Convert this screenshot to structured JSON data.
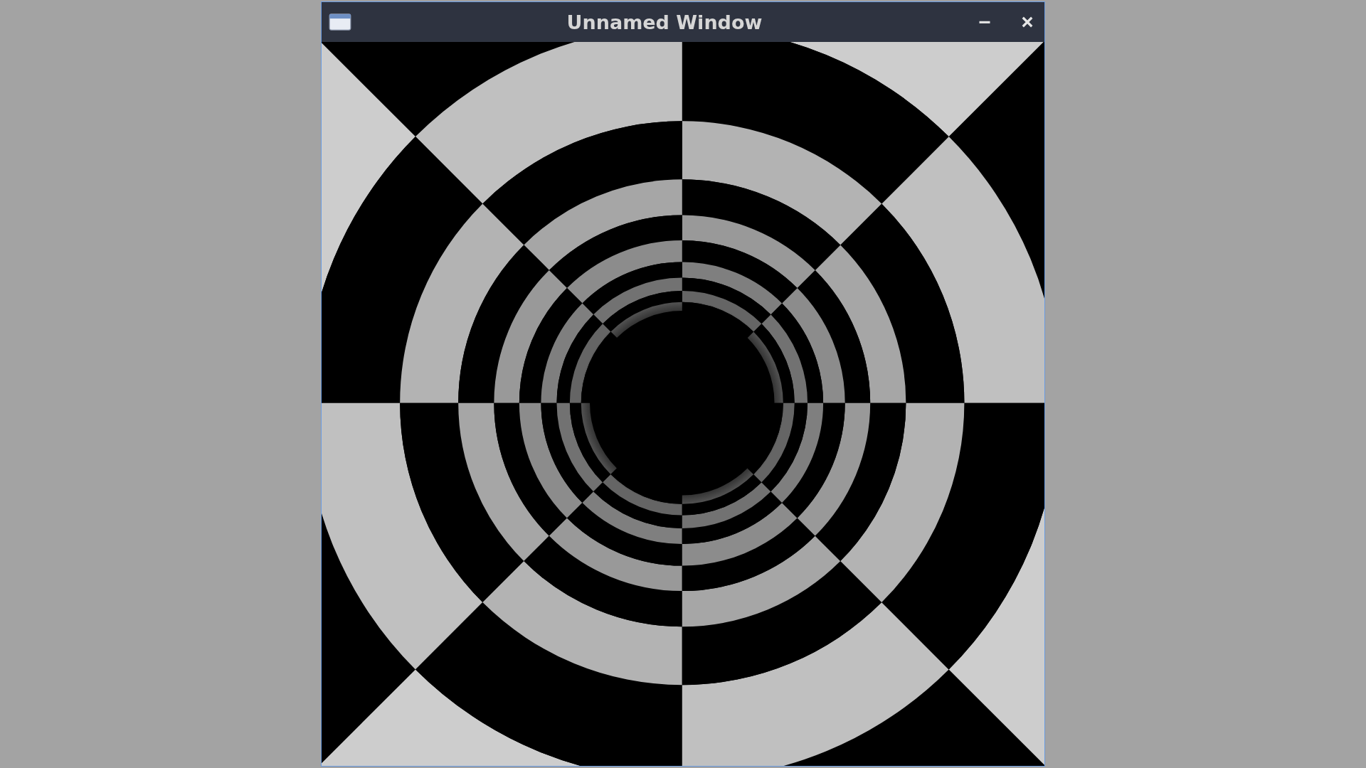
{
  "window": {
    "title": "Unnamed Window"
  }
}
